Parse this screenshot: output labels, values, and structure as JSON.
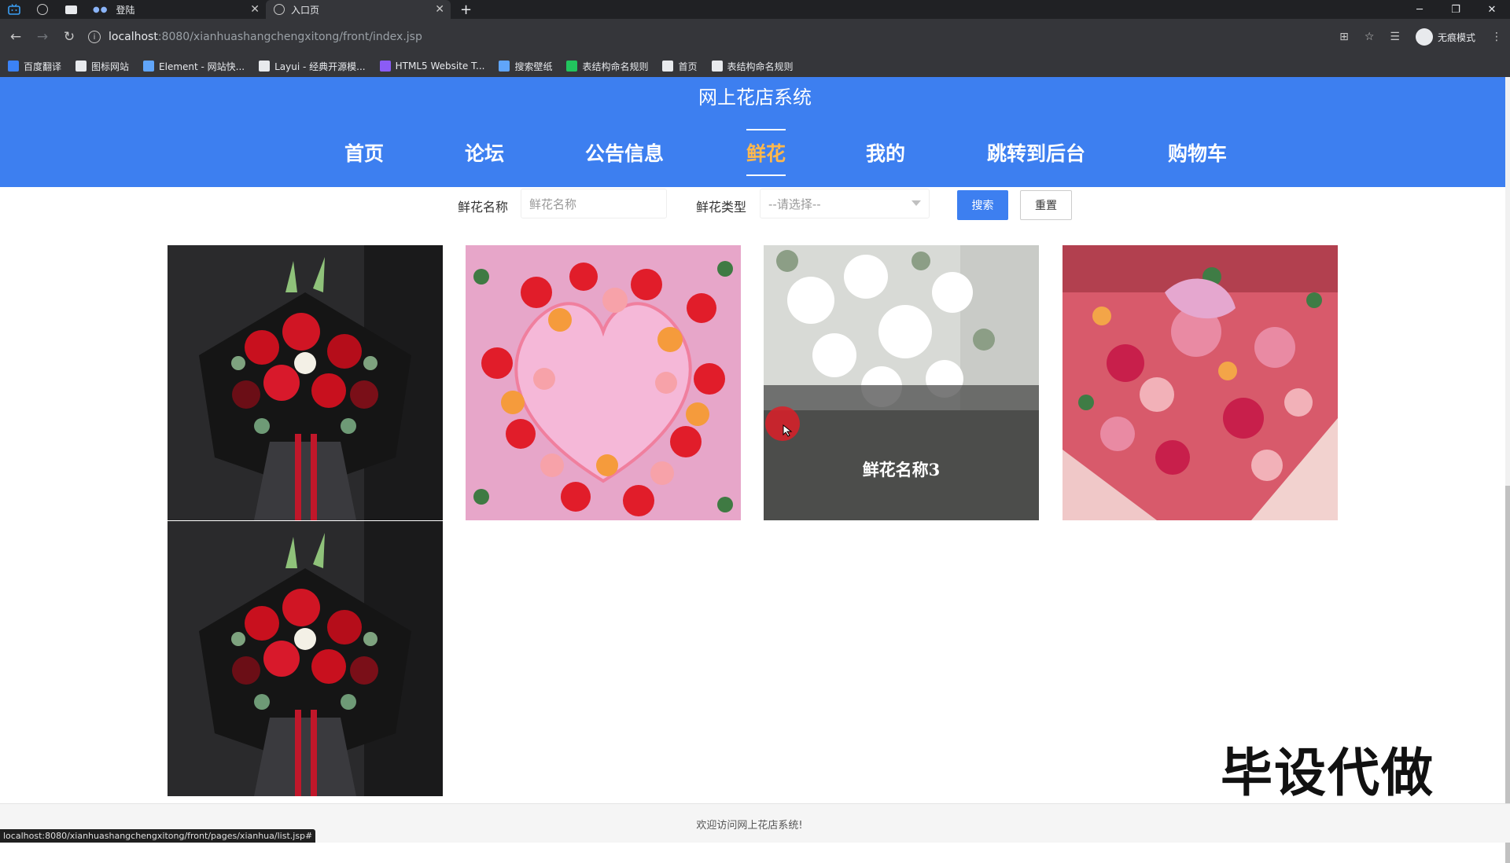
{
  "browser": {
    "tabs": [
      {
        "label": "登陆"
      },
      {
        "label": "入口页"
      }
    ],
    "url_host": "localhost",
    "url_path": ":8080/xianhuashangchengxitong/front/index.jsp",
    "incognito_label": "无痕模式",
    "bookmarks": [
      {
        "label": "百度翻译",
        "color": "#3b82f6"
      },
      {
        "label": "图标网站",
        "color": "#e8eaed"
      },
      {
        "label": "Element - 网站快...",
        "color": "#60a5fa"
      },
      {
        "label": "Layui - 经典开源模...",
        "color": "#e8eaed"
      },
      {
        "label": "HTML5 Website T...",
        "color": "#8b5cf6"
      },
      {
        "label": "搜索壁纸",
        "color": "#60a5fa"
      },
      {
        "label": "表结构命名规则",
        "color": "#22c55e"
      },
      {
        "label": "首页",
        "color": "#e8eaed"
      },
      {
        "label": "表结构命名规则",
        "color": "#e8eaed"
      }
    ],
    "status_url": "localhost:8080/xianhuashangchengxitong/front/pages/xianhua/list.jsp#"
  },
  "site": {
    "title": "网上花店系统",
    "nav": [
      {
        "label": "首页",
        "active": false
      },
      {
        "label": "论坛",
        "active": false
      },
      {
        "label": "公告信息",
        "active": false
      },
      {
        "label": "鲜花",
        "active": true
      },
      {
        "label": "我的",
        "active": false
      },
      {
        "label": "跳转到后台",
        "active": false
      },
      {
        "label": "购物车",
        "active": false
      }
    ],
    "active_color": "#ffb84d",
    "header_color": "#3d7ff0"
  },
  "search": {
    "name_label": "鲜花名称",
    "name_placeholder": "鲜花名称",
    "type_label": "鲜花类型",
    "type_selected": "--请选择--",
    "search_button": "搜索",
    "reset_button": "重置"
  },
  "products": [
    {
      "image": "red-roses-bouquet-black-wrap",
      "caption": ""
    },
    {
      "image": "rose-heart-arrangement",
      "caption": ""
    },
    {
      "image": "white-flowers-arrangement",
      "caption": "鲜花名称3"
    },
    {
      "image": "mixed-pink-bouquet",
      "caption": ""
    },
    {
      "image": "red-roses-bouquet-black-wrap",
      "caption": ""
    }
  ],
  "watermark": "毕设代做",
  "footer": {
    "text": "欢迎访问网上花店系统!"
  }
}
